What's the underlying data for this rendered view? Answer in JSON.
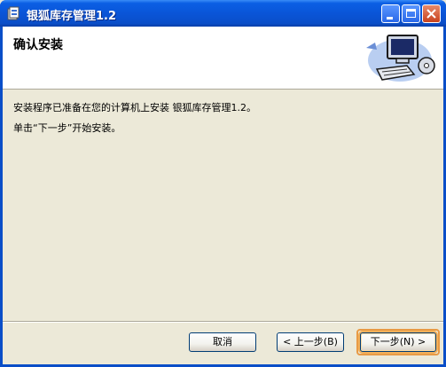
{
  "window": {
    "title": "银狐库存管理1.2"
  },
  "header": {
    "title": "确认安装"
  },
  "content": {
    "line1": "安装程序已准备在您的计算机上安装 银狐库存管理1.2。",
    "line2": "单击“下一步”开始安装。"
  },
  "buttons": {
    "cancel": "取消",
    "back": "< 上一步(B)",
    "next": "下一步(N) >"
  },
  "icons": {
    "title": "installer-icon",
    "header_art": "computer-cd-icon"
  },
  "colors": {
    "titlebar": "#0a55d8",
    "window_bg": "#ece9d8",
    "focus": "#e89a45"
  }
}
